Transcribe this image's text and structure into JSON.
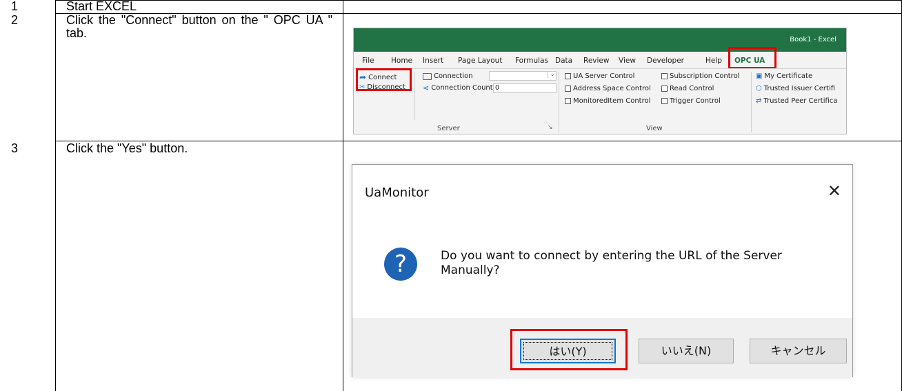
{
  "steps": [
    {
      "num": "1",
      "text": "Start EXCEL"
    },
    {
      "num": "2",
      "text": "Click the \"Connect\" button on the \" OPC UA \" tab."
    },
    {
      "num": "3",
      "text": "Click the \"Yes\" button."
    }
  ],
  "excel": {
    "window_title": "Book1  -  Excel",
    "tabs": [
      "File",
      "Home",
      "Insert",
      "Page Layout",
      "Formulas",
      "Data",
      "Review",
      "View",
      "Developer",
      "Help",
      "OPC UA"
    ],
    "active_tab": "OPC UA",
    "server_group": {
      "connect": "Connect",
      "disconnect": "Disconnect",
      "connection": "Connection",
      "connection_count": "Connection Count",
      "connection_count_value": "0",
      "label": "Server"
    },
    "view_group": {
      "items": [
        "UA Server Control",
        "Subscription Control",
        "Address Space Control",
        "Read Control",
        "MonitoredItem Control",
        "Trigger Control"
      ],
      "label": "View"
    },
    "cert_group": {
      "items": [
        "My Certificate",
        "Trusted Issuer Certifi",
        "Trusted Peer Certifica"
      ]
    },
    "colors": {
      "title_bar": "#217346",
      "highlight": "#e00000"
    }
  },
  "dialog": {
    "title": "UaMonitor",
    "close_icon": "close-icon",
    "message": "Do you want to connect by entering the URL of the Server Manually?",
    "icon": "question-icon",
    "buttons": {
      "yes": "はい(Y)",
      "no": "いいえ(N)",
      "cancel": "キャンセル"
    }
  }
}
